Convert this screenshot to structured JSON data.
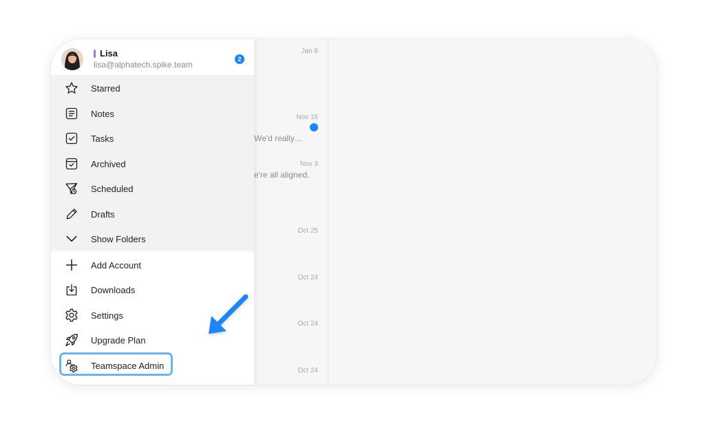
{
  "account": {
    "name": "Lisa",
    "email": "lisa@alphatech.spike.team",
    "badge_count": "2",
    "color_tag": "#9b7be0"
  },
  "folders": [
    {
      "label": "Starred",
      "icon": "star-icon"
    },
    {
      "label": "Notes",
      "icon": "notes-icon"
    },
    {
      "label": "Tasks",
      "icon": "tasks-icon"
    },
    {
      "label": "Archived",
      "icon": "archive-icon"
    },
    {
      "label": "Scheduled",
      "icon": "send-clock-icon"
    },
    {
      "label": "Drafts",
      "icon": "pencil-icon"
    },
    {
      "label": "Show Folders",
      "icon": "chevron-down-icon"
    }
  ],
  "actions": [
    {
      "label": "Add Account",
      "icon": "plus-icon"
    },
    {
      "label": "Downloads",
      "icon": "download-icon"
    },
    {
      "label": "Settings",
      "icon": "gear-icon"
    },
    {
      "label": "Upgrade Plan",
      "icon": "rocket-icon"
    },
    {
      "label": "Teamspace Admin",
      "icon": "teamspace-admin-icon"
    }
  ],
  "email_list": [
    {
      "date": "Jan 8",
      "snippet": "",
      "unread": false
    },
    {
      "date": "Nov 16",
      "snippet": "We'd really…",
      "unread": true
    },
    {
      "date": "Nov 3",
      "snippet": "e're all aligned.",
      "unread": false
    },
    {
      "date": "Oct 25",
      "snippet": "",
      "unread": false
    },
    {
      "date": "Oct 24",
      "snippet": "",
      "unread": false
    },
    {
      "date": "Oct 24",
      "snippet": "",
      "unread": false
    },
    {
      "date": "Oct 24",
      "snippet": "",
      "unread": false
    }
  ],
  "colors": {
    "accent": "#1a86f5",
    "highlight_border": "#6ab4f2",
    "pointer_arrow": "#1a86f5"
  }
}
